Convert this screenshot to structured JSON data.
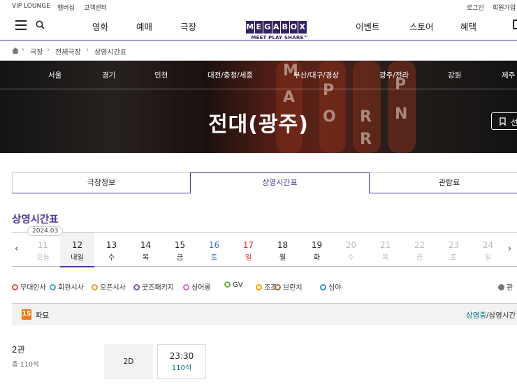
{
  "util_links": [
    "VIP LOUNGE",
    "멤버십",
    "고객센터",
    "로그인",
    "회원가입"
  ],
  "nav": {
    "items": [
      "영화",
      "예매",
      "극장",
      "이벤트",
      "스토어",
      "혜택"
    ],
    "logo_letters": [
      "M",
      "E",
      "G",
      "A",
      "B",
      "O",
      "X"
    ],
    "logo_tagline": "MEET PLAY SHARE™"
  },
  "breadcrumb": [
    "극장",
    "전체극장",
    "상영시간표"
  ],
  "hero": {
    "regions": [
      "서울",
      "경기",
      "인천",
      "대전/충청/세종",
      "부산/대구/경상",
      "광주/전라",
      "강원",
      "제주"
    ],
    "title": "전대(광주)",
    "favorite_label": "선",
    "backdrop_letters": [
      "M",
      "A",
      "P",
      "O",
      "R",
      "P",
      "R",
      "N"
    ]
  },
  "tabs": [
    "극장정보",
    "상영시간표",
    "관람료"
  ],
  "section_title": "상영시간표",
  "date_bar": {
    "year_month": "2024.03",
    "days": [
      {
        "num": "11",
        "wd": "오늘",
        "state": "disabled"
      },
      {
        "num": "12",
        "wd": "내일",
        "state": "active"
      },
      {
        "num": "13",
        "wd": "수",
        "state": "normal"
      },
      {
        "num": "14",
        "wd": "목",
        "state": "normal"
      },
      {
        "num": "15",
        "wd": "금",
        "state": "normal"
      },
      {
        "num": "16",
        "wd": "토",
        "state": "sat"
      },
      {
        "num": "17",
        "wd": "일",
        "state": "sun"
      },
      {
        "num": "18",
        "wd": "월",
        "state": "normal"
      },
      {
        "num": "19",
        "wd": "화",
        "state": "normal"
      },
      {
        "num": "20",
        "wd": "수",
        "state": "disabled"
      },
      {
        "num": "21",
        "wd": "목",
        "state": "disabled"
      },
      {
        "num": "22",
        "wd": "금",
        "state": "disabled"
      },
      {
        "num": "23",
        "wd": "토",
        "state": "disabled"
      },
      {
        "num": "24",
        "wd": "일",
        "state": "disabled"
      }
    ]
  },
  "legend": [
    {
      "label": "무대인사",
      "color": "#d9534f"
    },
    {
      "label": "회원시사",
      "color": "#4aa3c9"
    },
    {
      "label": "오픈시사",
      "color": "#e0a030"
    },
    {
      "label": "굿즈패키지",
      "color": "#7b4fc1"
    },
    {
      "label": "싱어롱",
      "color": "#d56ac9"
    },
    {
      "label": "GV",
      "color": "#6cb34a"
    },
    {
      "label": "조조",
      "color": "#f0a400"
    },
    {
      "label": "브런치",
      "color": "#a07040"
    },
    {
      "label": "심야",
      "color": "#3a8ed0"
    }
  ],
  "legend_right": "관",
  "movie": {
    "age_rating": "15",
    "title": "파묘",
    "status_active": "상영중",
    "status_rest": "/상영시간"
  },
  "hall": {
    "name": "2관",
    "total_seats": "총 110석",
    "format": "2D",
    "showtimes": [
      {
        "time": "23:30",
        "seats": "110석"
      }
    ]
  },
  "colors": {
    "brand": "#503396",
    "teal": "#01738b",
    "sat": "#2f6fd4",
    "sun": "#e8272f"
  }
}
